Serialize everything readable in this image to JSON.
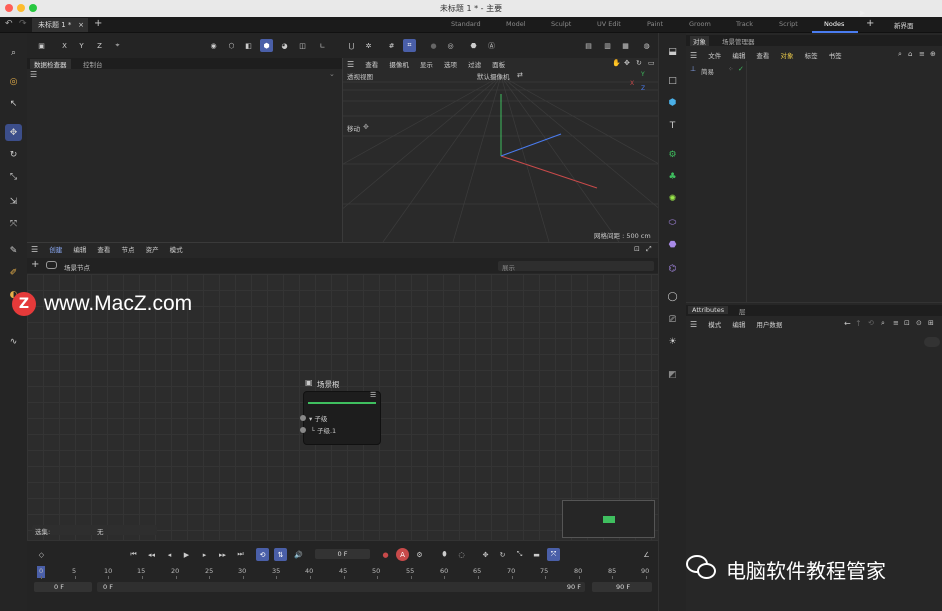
{
  "window": {
    "title": "未标题 1 * - 主要",
    "doc_tab": "未标题 1 *"
  },
  "layouts": {
    "items": [
      "Standard",
      "Model",
      "Sculpt",
      "UV Edit",
      "Paint",
      "Groom",
      "Track",
      "Script",
      "Nodes"
    ],
    "active": "Nodes",
    "new_layout": "新界面"
  },
  "axes": {
    "x": "X",
    "y": "Y",
    "z": "Z"
  },
  "data_panel": {
    "tabs": [
      "数据检查器",
      "控制台"
    ]
  },
  "viewport": {
    "menu": [
      "查看",
      "摄像机",
      "显示",
      "选项",
      "过滤",
      "面板"
    ],
    "view_name": "透视视图",
    "camera": "默认摄像机",
    "move_label": "移动",
    "grid_info": "网格间距 : 500 cm",
    "gizmo": {
      "y": "Y",
      "x": "X",
      "z": "Z"
    }
  },
  "nodes": {
    "menu": [
      "创建",
      "编辑",
      "查看",
      "节点",
      "资产",
      "模式"
    ],
    "breadcrumb": "场景节点",
    "display_label": "展示",
    "node_title": "场景根",
    "port_children": "▾ 子级",
    "port_child1": "└ 子级.1",
    "selection_label": "选集:",
    "selection_value": "无"
  },
  "objects": {
    "tabs": [
      "对象",
      "场景管理器"
    ],
    "menu": [
      "文件",
      "编辑",
      "查看",
      "对象",
      "标签",
      "书签"
    ],
    "item": "简易"
  },
  "attributes": {
    "tabs": [
      "Attributes",
      "层"
    ],
    "menu": [
      "模式",
      "编辑",
      "用户数据"
    ]
  },
  "timeline": {
    "current_frame": "0 F",
    "ticks": [
      "0",
      "5",
      "10",
      "15",
      "20",
      "25",
      "30",
      "35",
      "40",
      "45",
      "50",
      "55",
      "60",
      "65",
      "70",
      "75",
      "80",
      "85",
      "90"
    ],
    "start_frame": "0 F",
    "start_frame2": "0 F",
    "end_frame": "90 F",
    "end_frame2": "90 F"
  },
  "watermark": {
    "site": "www.MacZ.com",
    "badge": "Z",
    "account": "电脑软件教程管家"
  },
  "colors": {
    "accent": "#4a7cf0",
    "node_green": "#3fbf5f",
    "selected_tool": "#3c4e8a"
  }
}
